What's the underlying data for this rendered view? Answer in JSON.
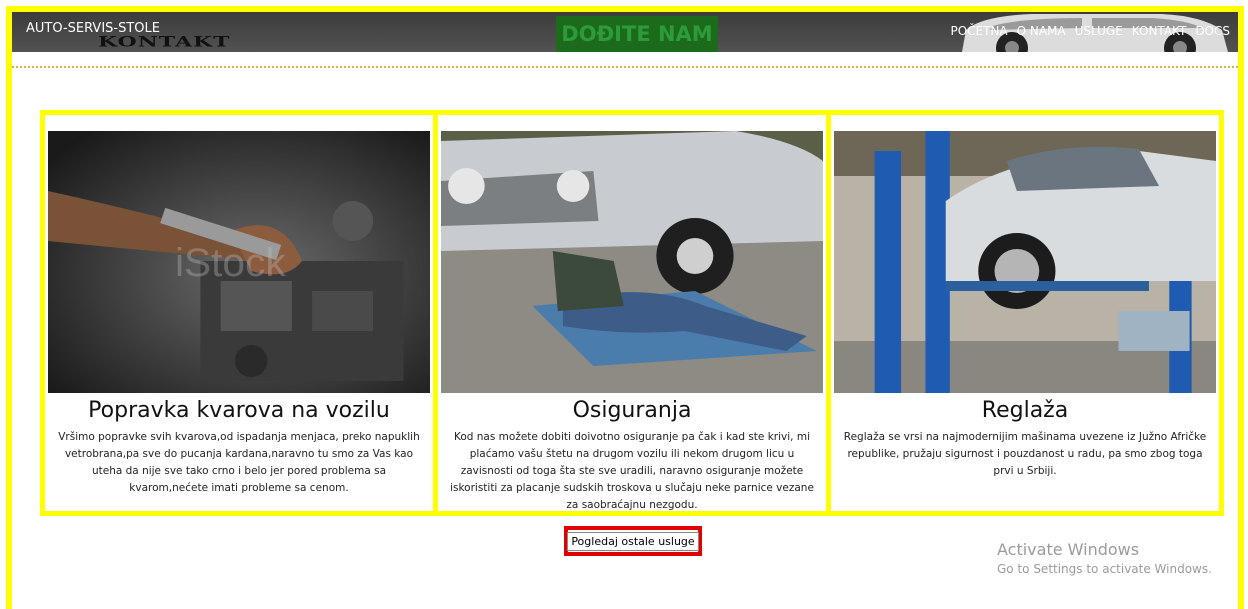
{
  "header": {
    "brand": "AUTO-SERVIS-STOLE",
    "page_heading": "KONTAKT",
    "cta": "DOĐITE NAM",
    "nav": [
      "POČETNA",
      "O NAMA",
      "USLUGE",
      "KONTAKT",
      "DOCS"
    ]
  },
  "services": [
    {
      "title": "Popravka kvarova na vozilu",
      "text": "Vršimo popravke svih kvarova,od ispadanja menjaca, preko napuklih vetrobrana,pa sve do pucanja kardana,naravno tu smo za Vas kao uteha da nije sve tako crno i belo jer pored problema sa kvarom,nećete imati probleme sa cenom."
    },
    {
      "title": "Osiguranja",
      "text": "Kod nas možete dobiti doivotno osiguranje pa čak i kad ste krivi, mi plaćamo vašu štetu na drugom vozilu ili nekom drugom licu u zavisnosti od toga šta ste sve uradili, naravno osiguranje možete iskoristiti za placanje sudskih troskova u slučaju neke parnice vezane za saobraćajnu nezgodu."
    },
    {
      "title": "Reglaža",
      "text": "Reglaža se vrsi na najmodernijim mašinama uvezene iz Južno Afričke republike, pružaju sigurnost i pouzdanost u radu, pa smo zbog toga prvi u Srbiji."
    }
  ],
  "more_button": "Pogledaj ostale usluge",
  "watermark": {
    "title": "Activate Windows",
    "subtitle": "Go to Settings to activate Windows."
  },
  "colors": {
    "highlight_border": "#ffff00",
    "button_border": "#e00000",
    "header_bg": "#474747",
    "cta_bg": "#1c6b1c"
  }
}
